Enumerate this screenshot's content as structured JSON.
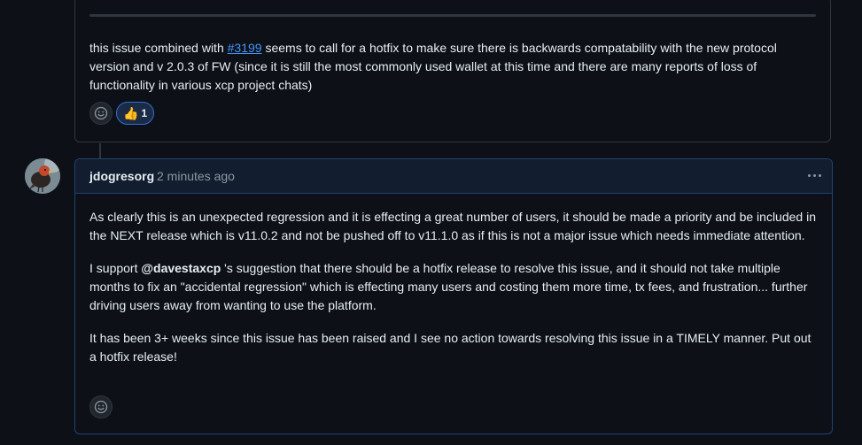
{
  "comment1": {
    "text_before_link": "this issue combined with ",
    "issue_link": "#3199",
    "text_after_link": " seems to call for a hotfix to make sure there is backwards compatability with the new protocol version and v 2.0.3 of FW (since it is still the most commonly used wallet at this time and there are many reports of loss of functionality in various xcp project chats)",
    "reactions": [
      {
        "emoji": "👍",
        "count": "1"
      }
    ]
  },
  "comment2": {
    "author": "jdogresorg",
    "timestamp": "2 minutes ago",
    "paragraph1": "As clearly this is an unexpected regression and it is effecting a great number of users, it should be made a priority and be included in the NEXT release which is v11.0.2 and not be pushed off to v11.1.0 as if this is not a major issue which needs immediate attention.",
    "paragraph2_before": "I support ",
    "mention": "@davestaxcp",
    "paragraph2_after": " 's suggestion that there should be a hotfix release to resolve this issue, and it should not take multiple months to fix an \"accidental regression\" which is effecting many users and costing them more time, tx fees, and frustration... further driving users away from wanting to use the platform.",
    "paragraph3": "It has been 3+ weeks since this issue has been raised and I see no action towards resolving this issue in a TIMELY manner. Put out a hotfix release!"
  },
  "icons": {
    "add_reaction": "smiley-icon",
    "more_options": "kebab-horizontal-icon"
  },
  "colors": {
    "background": "#0d1117",
    "link": "#4493f8",
    "border": "#30363d",
    "highlight_border": "#1f4273",
    "muted_text": "#8d96a0"
  }
}
